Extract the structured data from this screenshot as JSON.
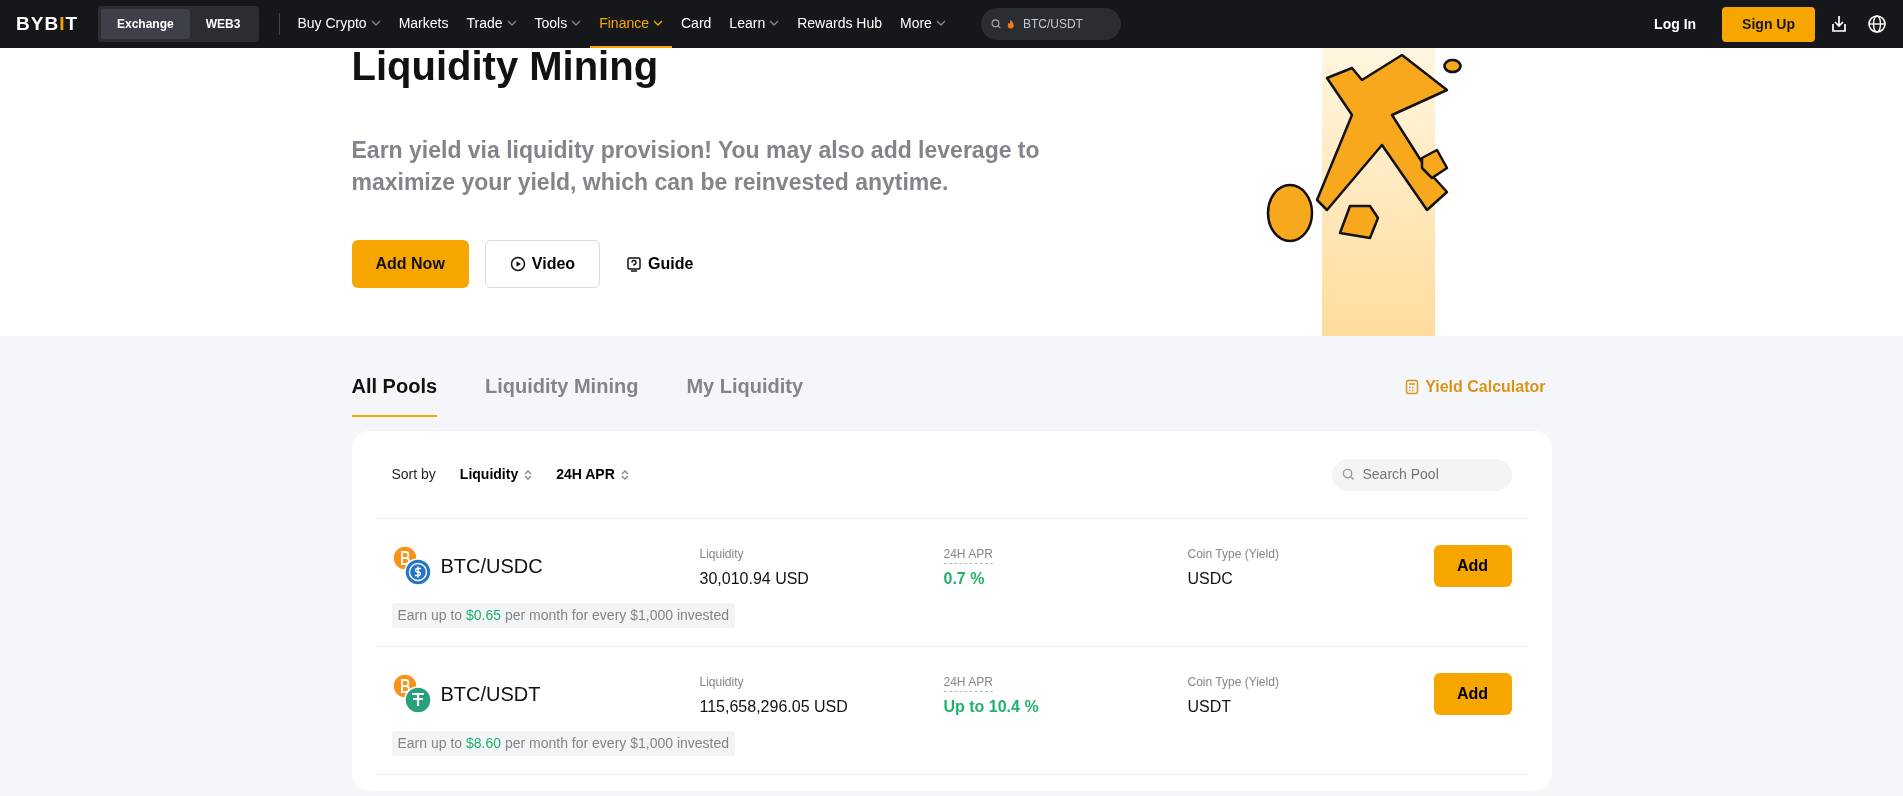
{
  "navbar": {
    "logo_parts": [
      {
        "text": "BYB",
        "accent": false
      },
      {
        "text": "I",
        "accent": true
      },
      {
        "text": "T",
        "accent": false
      }
    ],
    "switch": [
      {
        "label": "Exchange",
        "selected": true
      },
      {
        "label": "WEB3",
        "selected": false
      }
    ],
    "items": [
      {
        "label": "Buy Crypto",
        "dropdown": true,
        "selected": false
      },
      {
        "label": "Markets",
        "dropdown": false,
        "selected": false
      },
      {
        "label": "Trade",
        "dropdown": true,
        "selected": false
      },
      {
        "label": "Tools",
        "dropdown": true,
        "selected": false
      },
      {
        "label": "Finance",
        "dropdown": true,
        "selected": true
      },
      {
        "label": "Card",
        "dropdown": false,
        "selected": false
      },
      {
        "label": "Learn",
        "dropdown": true,
        "selected": false
      },
      {
        "label": "Rewards Hub",
        "dropdown": false,
        "selected": false
      },
      {
        "label": "More",
        "dropdown": true,
        "selected": false
      }
    ],
    "search": {
      "placeholder": "BTC/USDT"
    },
    "login": "Log In",
    "signup": "Sign Up"
  },
  "hero": {
    "title": "Liquidity Mining",
    "subtitle": "Earn yield via liquidity provision! You may also add leverage to maximize your yield, which can be reinvested anytime.",
    "buttons": [
      {
        "kind": "primary",
        "label": "Add Now"
      },
      {
        "kind": "outline",
        "label": "Video"
      },
      {
        "kind": "link",
        "label": "Guide"
      }
    ]
  },
  "tabs": [
    {
      "label": "All Pools",
      "selected": true
    },
    {
      "label": "Liquidity Mining",
      "selected": false
    },
    {
      "label": "My Liquidity",
      "selected": false
    }
  ],
  "yield_calculator": "Yield Calculator",
  "sort": {
    "label": "Sort by",
    "options": [
      "Liquidity",
      "24H APR"
    ]
  },
  "pool_search": {
    "placeholder": "Search Pool"
  },
  "pools": [
    {
      "pair": "BTC/USDC",
      "coins": [
        {
          "kind": "btc"
        },
        {
          "kind": "usdc"
        }
      ],
      "liquidity_label": "Liquidity",
      "liquidity": "30,010.94 USD",
      "apr_label": "24H APR",
      "apr": "0.7 %",
      "coin_type_label": "Coin Type (Yield)",
      "coin_type": "USDC",
      "button": "Add",
      "earn_prefix": "Earn up to",
      "earn_amount": "$0.65",
      "earn_suffix": "per month for every $1,000 invested"
    },
    {
      "pair": "BTC/USDT",
      "coins": [
        {
          "kind": "btc"
        },
        {
          "kind": "usdt"
        }
      ],
      "liquidity_label": "Liquidity",
      "liquidity": "115,658,296.05 USD",
      "apr_label": "24H APR",
      "apr": "Up to 10.4 %",
      "coin_type_label": "Coin Type (Yield)",
      "coin_type": "USDT",
      "button": "Add",
      "earn_prefix": "Earn up to",
      "earn_amount": "$8.60",
      "earn_suffix": "per month for every $1,000 invested"
    }
  ]
}
